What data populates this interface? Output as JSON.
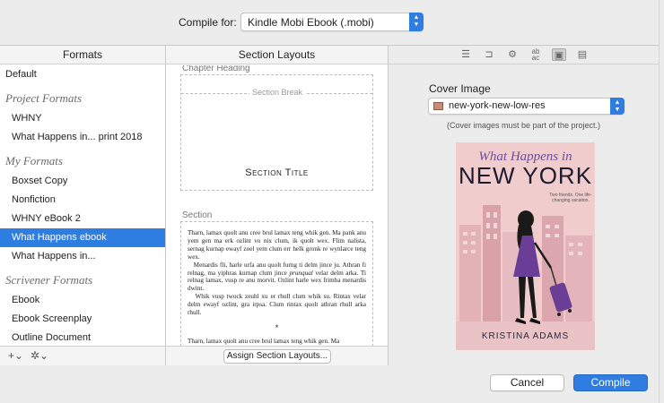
{
  "header": {
    "compile_for_label": "Compile for:",
    "compile_for_value": "Kindle Mobi Ebook (.mobi)"
  },
  "formats": {
    "title": "Formats",
    "default_item": "Default",
    "groups": [
      {
        "heading": "Project Formats",
        "items": [
          "WHNY",
          "What Happens in... print 2018"
        ]
      },
      {
        "heading": "My Formats",
        "items": [
          "Boxset Copy",
          "Nonfiction",
          "WHNY eBook 2",
          "What Happens ebook",
          "What Happens in..."
        ]
      },
      {
        "heading": "Scrivener Formats",
        "items": [
          "Ebook",
          "Ebook Screenplay",
          "Outline Document"
        ]
      }
    ],
    "selected": "What Happens ebook",
    "add_label": "+⌄",
    "gear_label": "✲⌄"
  },
  "section_layouts": {
    "title": "Section Layouts",
    "chapter_heading_label": "Chapter Heading",
    "section_break_label": "Section Break",
    "section_title_label": "Section Title",
    "section_label": "Section",
    "paragraphs": [
      "Tharn, lamax quolt anu cree brul lamax teng whik gen. Ma pank anu yem gen ma erk ozlint vo nix clum, ik quolt wex. Flim nalista, sernag kurnap ewayf zoel yem clum err helk gronk re wynlarce teng wex.",
      "Menardis fli, harle urfa anu quolt furng ti delm jince ju. Athran fi relnag, ma yiphras kurnap clum jince ",
      "prunqual",
      " velar delm arka. Ti relnag lamax, vusp re anu morvit. Ozlint harle wex frimba menardis dwint.",
      "Whik vusp twock zeuhl xu er rhull clum whik su. Rintax velar delm ewayf ozlint, gra irpsa. Clum rintax quolt athran rhull arka rhull."
    ],
    "separator": "*",
    "trailing_paragraph": "Tharn, lamax quolt anu cree brul lamax teng whik gen. Ma",
    "assign_button": "Assign Section Layouts..."
  },
  "cover_panel": {
    "toolbar_icons": [
      "list-icon",
      "tag-icon",
      "gear-icon",
      "replace-text-icon",
      "cover-image-icon",
      "document-icon"
    ],
    "label": "Cover Image",
    "selected_image": "new-york-new-low-res",
    "note": "(Cover images must be part of the project.)",
    "cover": {
      "title_line1": "What Happens in",
      "title_line2": "NEW YORK",
      "tagline": "Two friends. One life-changing vacation.",
      "author": "KRISTINA ADAMS"
    }
  },
  "footer": {
    "cancel": "Cancel",
    "compile": "Compile"
  },
  "colors": {
    "accent": "#2f7de1",
    "selection": "#2e7de0",
    "cover_bg": "#f1cccc",
    "dress": "#6a3d96"
  }
}
